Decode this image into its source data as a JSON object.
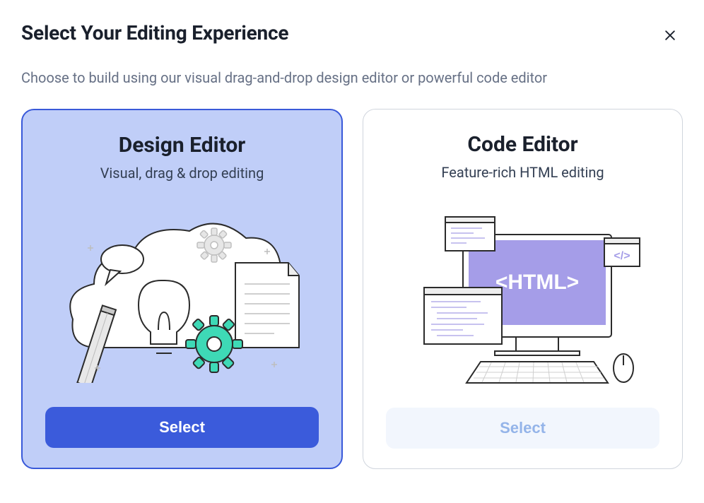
{
  "header": {
    "title": "Select Your Editing Experience",
    "subtitle": "Choose to build using our visual drag-and-drop design editor or powerful code editor"
  },
  "cards": {
    "design": {
      "title": "Design Editor",
      "subtitle": "Visual, drag & drop editing",
      "button": "Select"
    },
    "code": {
      "title": "Code Editor",
      "subtitle": "Feature-rich HTML editing",
      "screen_label": "<HTML>",
      "code_tag": "</>",
      "button": "Select"
    }
  },
  "colors": {
    "primary": "#3B5BDB",
    "selected_bg": "#C0CEF8",
    "border": "#d0d5dd",
    "text_muted": "#667085",
    "accent_teal": "#3ED9B6",
    "lavender": "#A59DE8"
  }
}
